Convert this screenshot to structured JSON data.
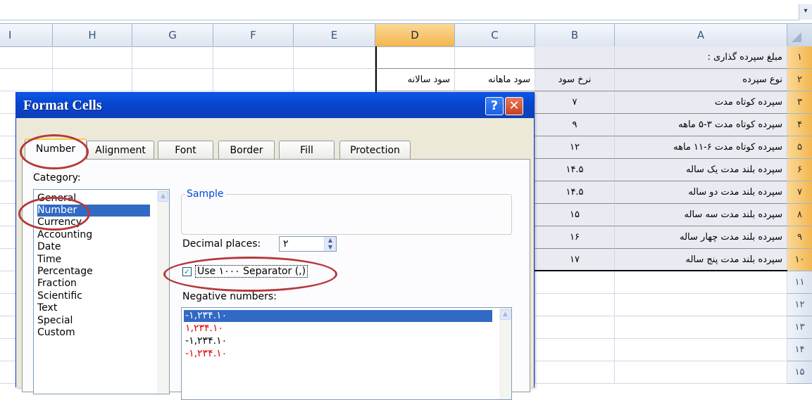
{
  "columns": [
    {
      "id": "I",
      "label": "I"
    },
    {
      "id": "H",
      "label": "H"
    },
    {
      "id": "G",
      "label": "G"
    },
    {
      "id": "F",
      "label": "F"
    },
    {
      "id": "E",
      "label": "E"
    },
    {
      "id": "D",
      "label": "D"
    },
    {
      "id": "C",
      "label": "C"
    },
    {
      "id": "B",
      "label": "B"
    },
    {
      "id": "A",
      "label": "A"
    }
  ],
  "rows": [
    {
      "num": "١",
      "A": "مبلغ سپرده گذاری :",
      "B": "",
      "C": "",
      "D": ""
    },
    {
      "num": "٢",
      "A": "نوع سپرده",
      "B": "نرخ سود",
      "C": "سود ماهانه",
      "D": "سود سالانه"
    },
    {
      "num": "٣",
      "A": "سپرده کوتاه مدت",
      "B": "٧",
      "C": "",
      "D": ""
    },
    {
      "num": "۴",
      "A": "سپرده کوتاه مدت ٣-۵ ماهه",
      "B": "٩",
      "C": "",
      "D": ""
    },
    {
      "num": "۵",
      "A": "سپرده کوتاه مدت ۶-١١ ماهه",
      "B": "١٢",
      "C": "",
      "D": ""
    },
    {
      "num": "۶",
      "A": "سپرده بلند مدت یک ساله",
      "B": "١۴.۵",
      "C": "",
      "D": ""
    },
    {
      "num": "٧",
      "A": "سپرده بلند مدت دو ساله",
      "B": "١۴.۵",
      "C": "",
      "D": ""
    },
    {
      "num": "٨",
      "A": "سپرده بلند مدت سه ساله",
      "B": "١۵",
      "C": "",
      "D": ""
    },
    {
      "num": "٩",
      "A": "سپرده بلند مدت چهار ساله",
      "B": "١۶",
      "C": "",
      "D": ""
    },
    {
      "num": "١٠",
      "A": "سپرده بلند مدت پنج ساله",
      "B": "١٧",
      "C": "",
      "D": ""
    },
    {
      "num": "١١",
      "A": "",
      "B": "",
      "C": "",
      "D": ""
    },
    {
      "num": "١٢",
      "A": "",
      "B": "",
      "C": "",
      "D": ""
    },
    {
      "num": "١٣",
      "A": "",
      "B": "",
      "C": "",
      "D": ""
    },
    {
      "num": "١۴",
      "A": "",
      "B": "",
      "C": "",
      "D": ""
    },
    {
      "num": "١۵",
      "A": "",
      "B": "",
      "C": "",
      "D": ""
    }
  ],
  "dialog": {
    "title": "Format Cells",
    "help_label": "?",
    "close_label": "✕",
    "tabs": [
      "Number",
      "Alignment",
      "Font",
      "Border",
      "Fill",
      "Protection"
    ],
    "active_tab": "Number",
    "category_label": "Category:",
    "categories": [
      "General",
      "Number",
      "Currency",
      "Accounting",
      "Date",
      "Time",
      "Percentage",
      "Fraction",
      "Scientific",
      "Text",
      "Special",
      "Custom"
    ],
    "selected_category": "Number",
    "sample_label": "Sample",
    "decimal_places_label": "Decimal places:",
    "decimal_places_value": "٢",
    "separator_label": "Use ١٠٠٠ Separator (,)",
    "separator_checked": true,
    "negative_numbers_label": "Negative numbers:",
    "negative_numbers": [
      {
        "text": "-١,٢٣۴.١٠",
        "color": "#ffffff",
        "selected": true
      },
      {
        "text": "١,٢٣۴.١٠",
        "color": "#e00000",
        "selected": false
      },
      {
        "text": "-١,٢٣۴.١٠",
        "color": "#000000",
        "selected": false
      },
      {
        "text": "-١,٢٣۴.١٠",
        "color": "#e00000",
        "selected": false
      }
    ]
  },
  "colors": {
    "selected_header": "#f3b650",
    "titlebar": "#0746d0",
    "highlight": "#316ac5",
    "annotation_ring": "#b53a3a"
  }
}
